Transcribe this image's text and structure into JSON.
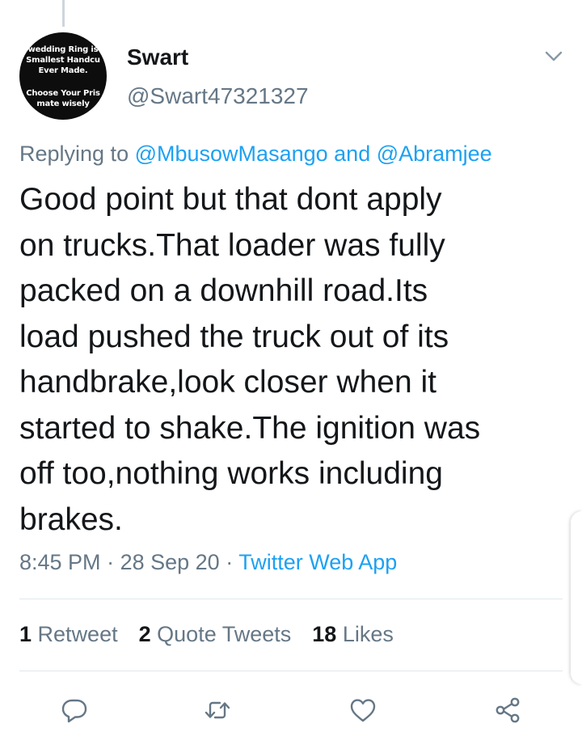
{
  "author": {
    "display_name": "Swart",
    "handle": "@Swart47321327",
    "avatar_lines": [
      "wedding Ring is",
      "Smallest Handcu",
      "Ever Made.",
      "Choose Your Pris",
      "mate wisely"
    ]
  },
  "reply_context": {
    "prefix": "Replying to",
    "mention_1": "@MbusowMasango",
    "joiner": "and",
    "mention_2": "@Abramjee"
  },
  "tweet": {
    "lines": [
      "Good point but that dont apply",
      "on trucks.That loader was fully",
      "packed on a downhill road.Its",
      "load pushed the truck out of its",
      "handbrake,look closer when it",
      "started to shake.The ignition was",
      "off too,nothing works including",
      "brakes."
    ],
    "time": "8:45 PM",
    "separator": "·",
    "date": "28 Sep 20",
    "source": "Twitter Web App"
  },
  "stats": {
    "retweets_count": "1",
    "retweets_label": "Retweet",
    "quotes_count": "2",
    "quotes_label": "Quote Tweets",
    "likes_count": "18",
    "likes_label": "Likes"
  },
  "icons": {
    "caret": "chevron-down-icon",
    "reply": "reply-icon",
    "retweet": "retweet-icon",
    "like": "heart-icon",
    "share": "share-icon"
  },
  "colors": {
    "text": "#14171a",
    "secondary": "#657786",
    "accent": "#1da1f2",
    "divider": "#e1e8ed"
  }
}
